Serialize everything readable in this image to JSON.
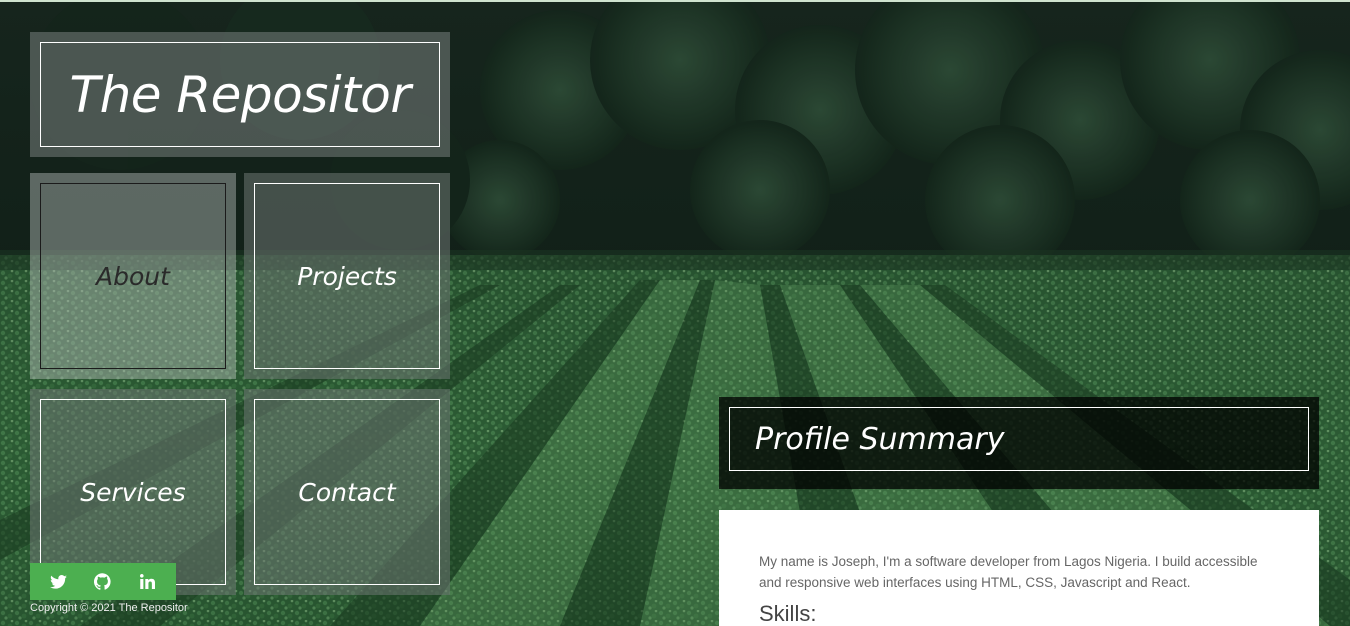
{
  "site": {
    "title": "The Repositor"
  },
  "nav": {
    "items": [
      {
        "label": "About",
        "active": true
      },
      {
        "label": "Projects",
        "active": false
      },
      {
        "label": "Services",
        "active": false
      },
      {
        "label": "Contact",
        "active": false
      }
    ]
  },
  "social": {
    "bar_color": "#4caf50",
    "links": [
      {
        "icon": "twitter-icon"
      },
      {
        "icon": "github-icon"
      },
      {
        "icon": "linkedin-icon"
      }
    ]
  },
  "footer": {
    "copyright": "Copyright © 2021 The Repositor"
  },
  "profile": {
    "heading": "Profile Summary",
    "text": "My name is Joseph, I'm a software developer from Lagos Nigeria. I build accessible and responsive web interfaces using HTML, CSS, Javascript and React.",
    "skills_heading": "Skills:"
  },
  "colors": {
    "accent": "#4caf50",
    "overlay_dark": "#000000",
    "background_field": "#1f4a28"
  }
}
